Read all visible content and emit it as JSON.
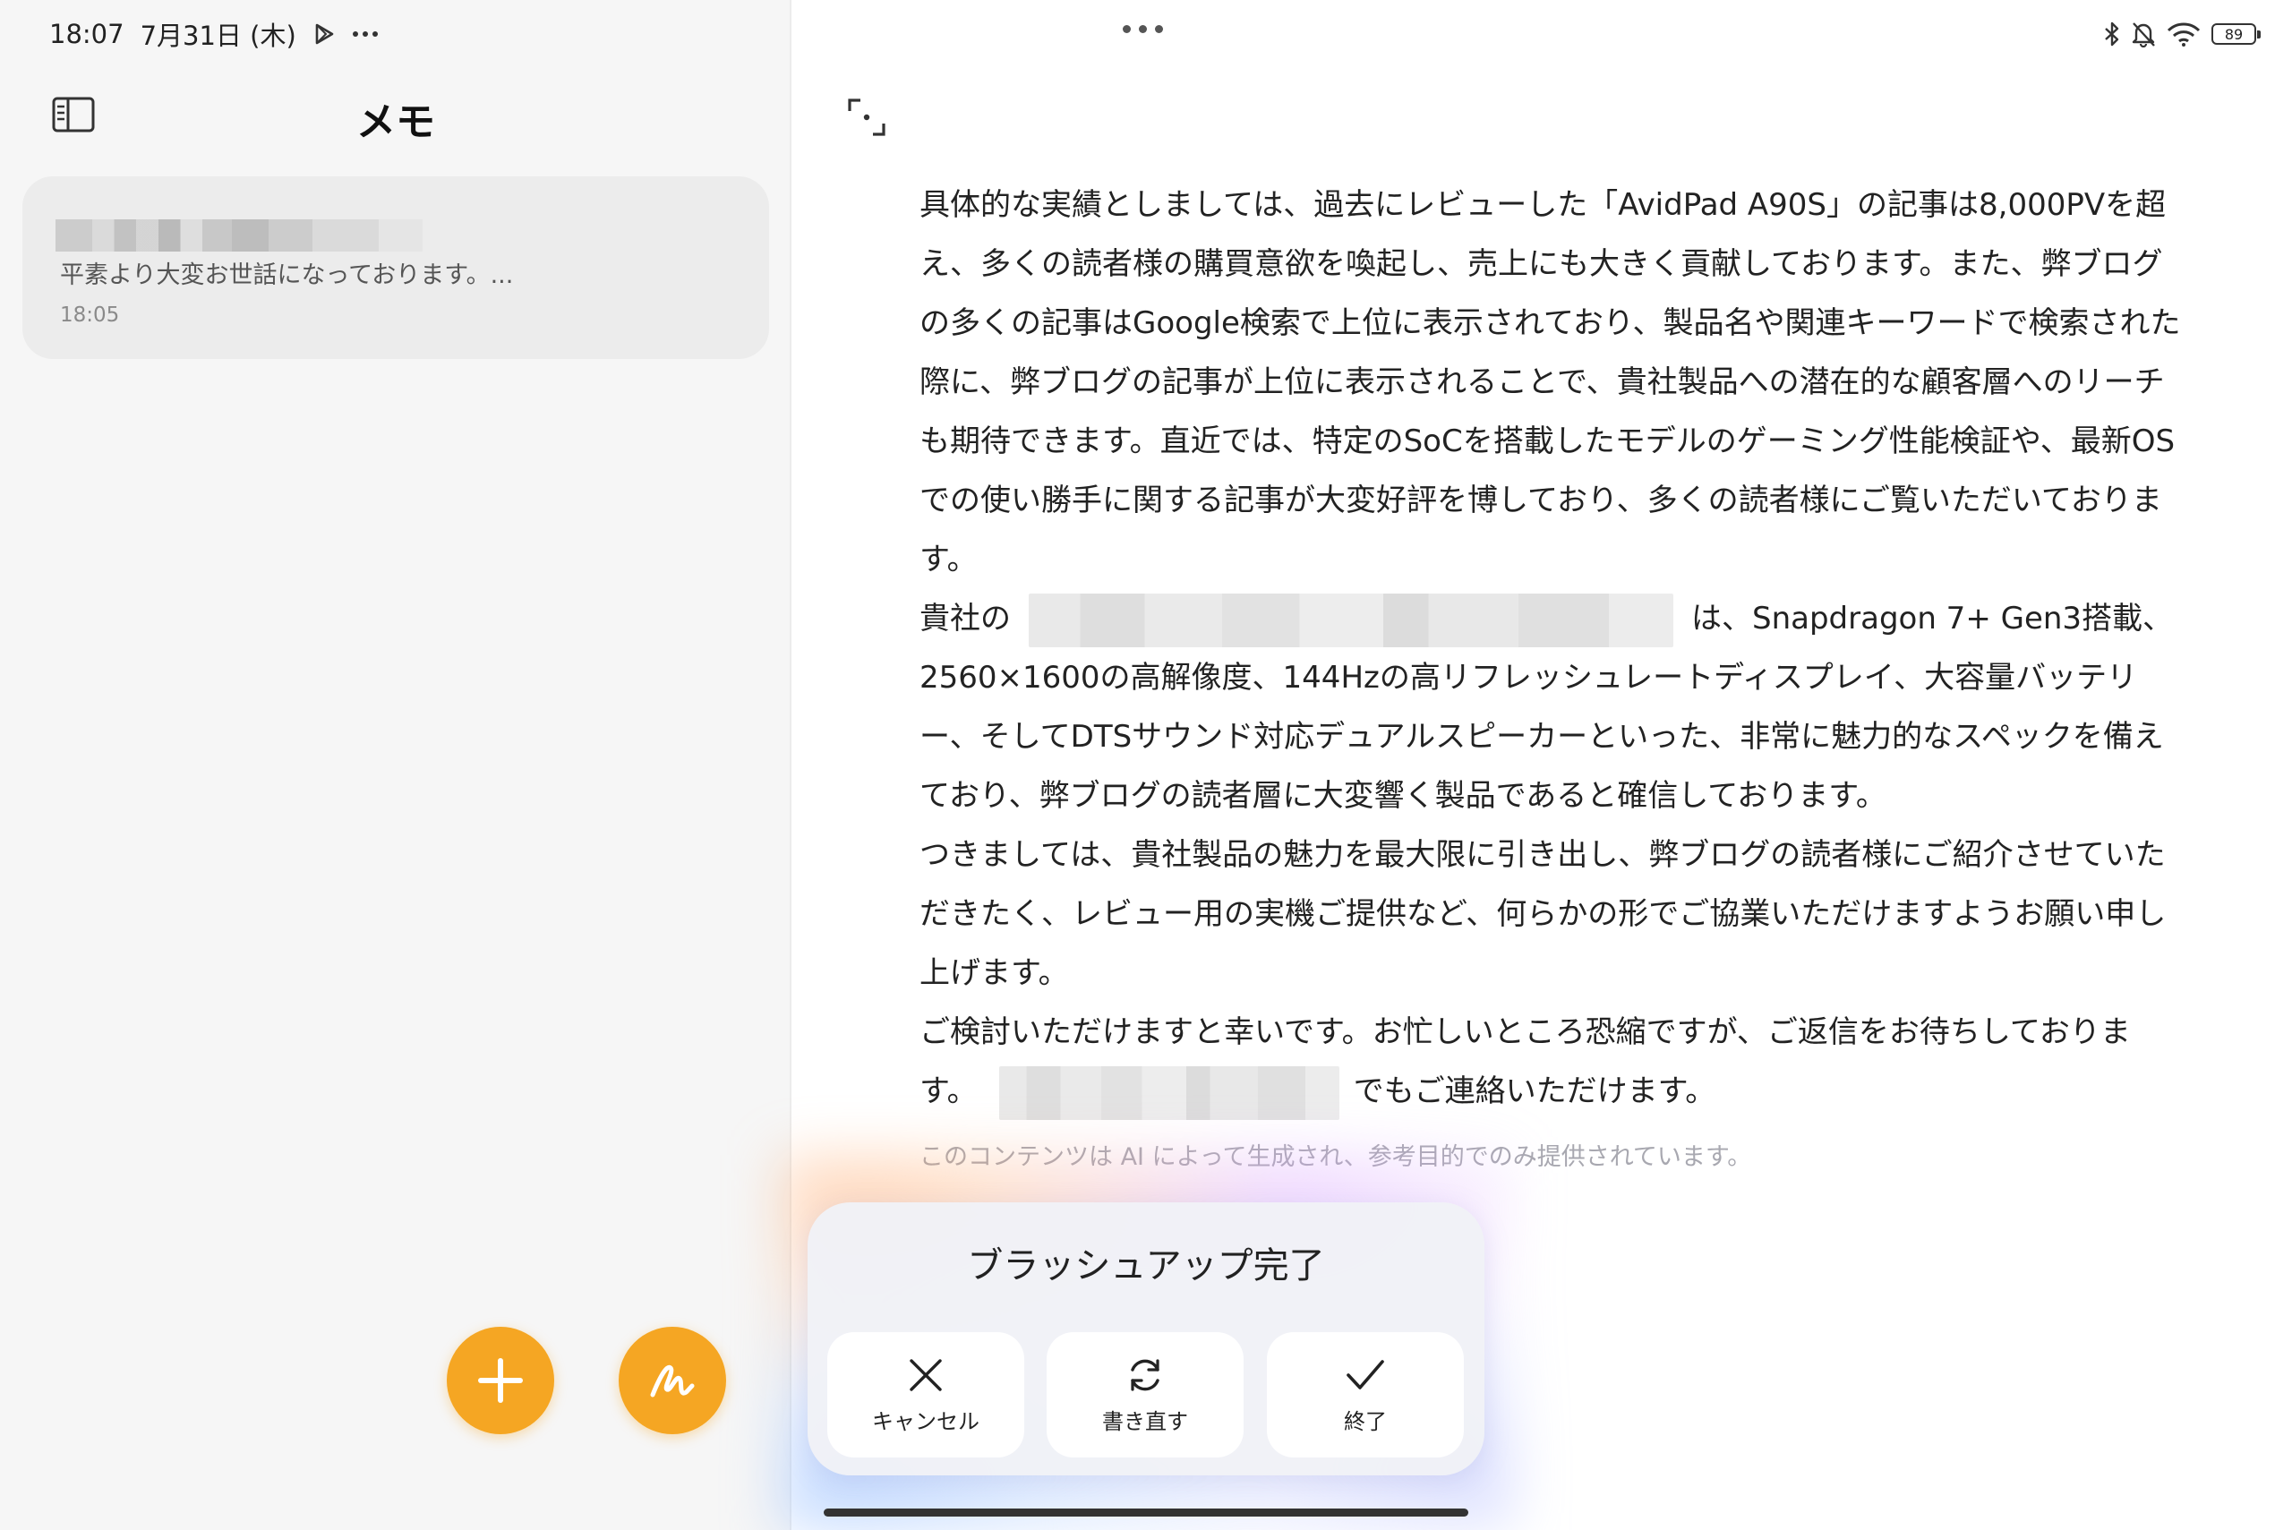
{
  "status_bar": {
    "time": "18:07",
    "date": "7月31日 (木)",
    "battery": "89",
    "icons": [
      "play-store-icon",
      "more-icon",
      "bluetooth-icon",
      "bell-muted-icon",
      "wifi-icon",
      "battery-icon"
    ]
  },
  "sidebar": {
    "title": "メモ",
    "notes": [
      {
        "preview": "平素より大変お世話になっております。...",
        "time": "18:05"
      }
    ]
  },
  "editor": {
    "paragraphs": {
      "p1": "具体的な実績としましては、過去にレビューした「AvidPad A90S」の記事は8,000PVを超え、多くの読者様の購買意欲を喚起し、売上にも大きく貢献しております。また、弊ブログの多くの記事はGoogle検索で上位に表示されており、製品名や関連キーワードで検索された際に、弊ブログの記事が上位に表示されることで、貴社製品への潜在的な顧客層へのリーチも期待できます。直近では、特定のSoCを搭載したモデルのゲーミング性能検証や、最新OSでの使い勝手に関する記事が大変好評を博しており、多くの読者様にご覧いただいております。",
      "p2_start": "貴社の",
      "p2_rest": "は、Snapdragon 7+ Gen3搭載、2560×1600の高解像度、144Hzの高リフレッシュレートディスプレイ、大容量バッテリー、そしてDTSサウンド対応デュアルスピーカーといった、非常に魅力的なスペックを備えており、弊ブログの読者層に大変響く製品であると確信しております。",
      "p3": "つきましては、貴社製品の魅力を最大限に引き出し、弊ブログの読者様にご紹介させていただきたく、レビュー用の実機ご提供など、何らかの形でご協業いただけますようお願い申し上げます。",
      "p4_start": "ご検討いただけますと幸いです。お忙しいところ恐縮ですが、ご返信をお待ちしております。",
      "p4_end": "でもご連絡いただけます。"
    },
    "ai_notice": "このコンテンツは AI によって生成され、参考目的でのみ提供されています。"
  },
  "dialog": {
    "title": "ブラッシュアップ完了",
    "cancel_label": "キャンセル",
    "rewrite_label": "書き直す",
    "done_label": "終了"
  },
  "colors": {
    "accent": "#f5a623",
    "sidebar_bg": "#f6f6f6",
    "card_bg": "#ececec",
    "dialog_bg": "#f0f1f7"
  }
}
